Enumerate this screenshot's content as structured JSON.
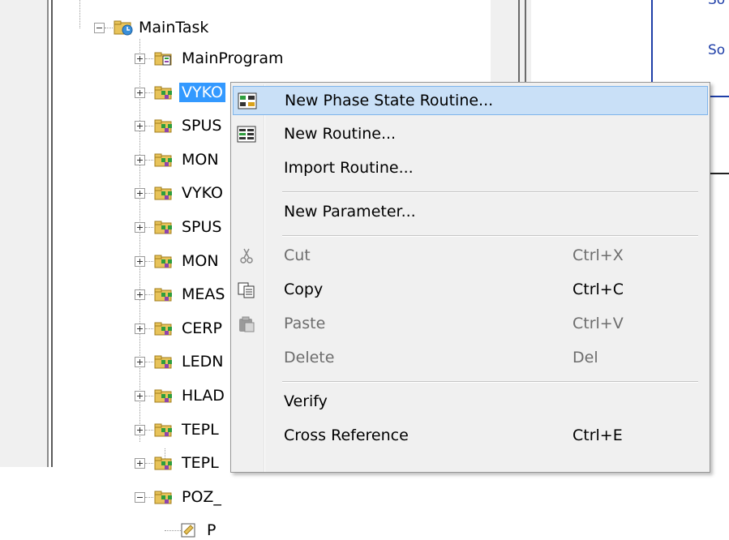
{
  "tree": {
    "root": {
      "label": "MainTask",
      "expanded": true
    },
    "items": [
      {
        "label": "MainProgram",
        "icon": "main-program-icon"
      },
      {
        "label": "VYKO",
        "icon": "phase-icon",
        "selected": true
      },
      {
        "label": "SPUS",
        "icon": "phase-icon"
      },
      {
        "label": "MON",
        "icon": "phase-icon"
      },
      {
        "label": "VYKO",
        "icon": "phase-icon"
      },
      {
        "label": "SPUS",
        "icon": "phase-icon"
      },
      {
        "label": "MON",
        "icon": "phase-icon"
      },
      {
        "label": "MEAS",
        "icon": "phase-icon"
      },
      {
        "label": "CERP",
        "icon": "phase-icon"
      },
      {
        "label": "LEDN",
        "icon": "phase-icon"
      },
      {
        "label": "HLAD",
        "icon": "phase-icon"
      },
      {
        "label": "TEPL",
        "icon": "phase-icon"
      },
      {
        "label": "TEPL",
        "icon": "phase-icon"
      },
      {
        "label": "POZ_",
        "icon": "phase-icon",
        "expanded": true
      },
      {
        "label": "P",
        "icon": "routine-icon"
      }
    ]
  },
  "right_pane": {
    "line1": "So",
    "line2": "So"
  },
  "context_menu": {
    "items": [
      {
        "label": "New Phase State Routine...",
        "shortcut": "",
        "icon": "phase-state-routine-icon",
        "highlighted": true,
        "disabled": false
      },
      {
        "label": "New Routine...",
        "shortcut": "",
        "icon": "new-routine-icon",
        "disabled": false
      },
      {
        "label": "Import Routine...",
        "shortcut": "",
        "icon": "",
        "disabled": false
      },
      {
        "separator": true
      },
      {
        "label": "New Parameter...",
        "shortcut": "",
        "icon": "",
        "disabled": false
      },
      {
        "separator": true
      },
      {
        "label": "Cut",
        "shortcut": "Ctrl+X",
        "icon": "scissors-icon",
        "disabled": true
      },
      {
        "label": "Copy",
        "shortcut": "Ctrl+C",
        "icon": "copy-icon",
        "disabled": false
      },
      {
        "label": "Paste",
        "shortcut": "Ctrl+V",
        "icon": "paste-icon",
        "disabled": true
      },
      {
        "label": "Delete",
        "shortcut": "Del",
        "icon": "",
        "disabled": true
      },
      {
        "separator": true
      },
      {
        "label": "Verify",
        "shortcut": "",
        "icon": "",
        "disabled": false
      },
      {
        "label": "Cross Reference",
        "shortcut": "Ctrl+E",
        "icon": "",
        "disabled": false
      }
    ]
  },
  "colors": {
    "selection": "#3399ff",
    "menu_highlight": "#c9e0f7",
    "menu_highlight_border": "#7eb4ea",
    "right_pane_accent": "#1f3fa8"
  }
}
